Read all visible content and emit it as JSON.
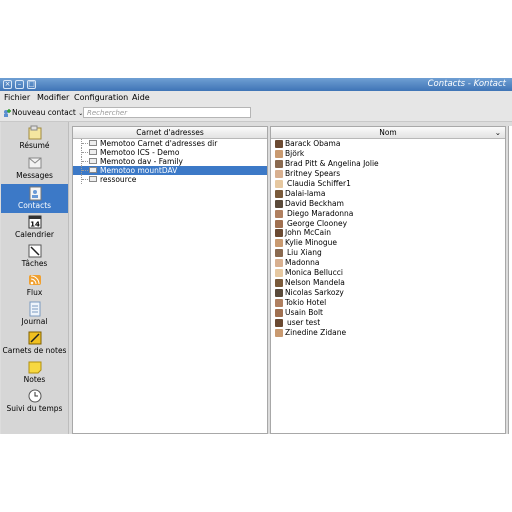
{
  "window": {
    "title": "Contacts - Kontact"
  },
  "menu": [
    "Fichier",
    "Modifier",
    "Configuration",
    "Aide"
  ],
  "toolbar": {
    "new_contact": "Nouveau contact",
    "search_placeholder": "Rechercher"
  },
  "sidebar": {
    "items": [
      {
        "label": "Résumé",
        "icon": "summary-icon"
      },
      {
        "label": "Messages",
        "icon": "mail-icon"
      },
      {
        "label": "Contacts",
        "icon": "contacts-icon",
        "selected": true
      },
      {
        "label": "Calendrier",
        "icon": "calendar-icon",
        "badge": "14"
      },
      {
        "label": "Tâches",
        "icon": "tasks-icon"
      },
      {
        "label": "Flux",
        "icon": "feeds-icon"
      },
      {
        "label": "Journal",
        "icon": "journal-icon"
      },
      {
        "label": "Carnets de notes",
        "icon": "notebook-icon"
      },
      {
        "label": "Notes",
        "icon": "notes-icon"
      },
      {
        "label": "Suivi du temps",
        "icon": "clock-icon"
      }
    ]
  },
  "addressbooks": {
    "header": "Carnet d'adresses",
    "items": [
      {
        "label": "Memotoo Carnet d'adresses dir"
      },
      {
        "label": "Memotoo ICS - Demo"
      },
      {
        "label": "Memotoo dav - Family"
      },
      {
        "label": "Memotoo mountDAV",
        "selected": true
      },
      {
        "label": "ressource"
      }
    ]
  },
  "contacts": {
    "header": "Nom",
    "items": [
      "Barack Obama",
      "Björk",
      "Brad Pitt & Angelina Jolie",
      "Britney Spears",
      "Claudia Schiffer1",
      "Dalai-lama",
      "David Beckham",
      "Diego Maradonna",
      "George Clooney",
      "John McCain",
      "Kylie Minogue",
      "Liu Xiang",
      "Madonna",
      "Monica Bellucci",
      "Nelson Mandela",
      "Nicolas Sarkozy",
      "Tokio Hotel",
      "Usain Bolt",
      "user test",
      "Zinedine Zidane"
    ]
  },
  "colors": {
    "selection": "#3c79c7",
    "titlebar": "#4f85c4"
  }
}
